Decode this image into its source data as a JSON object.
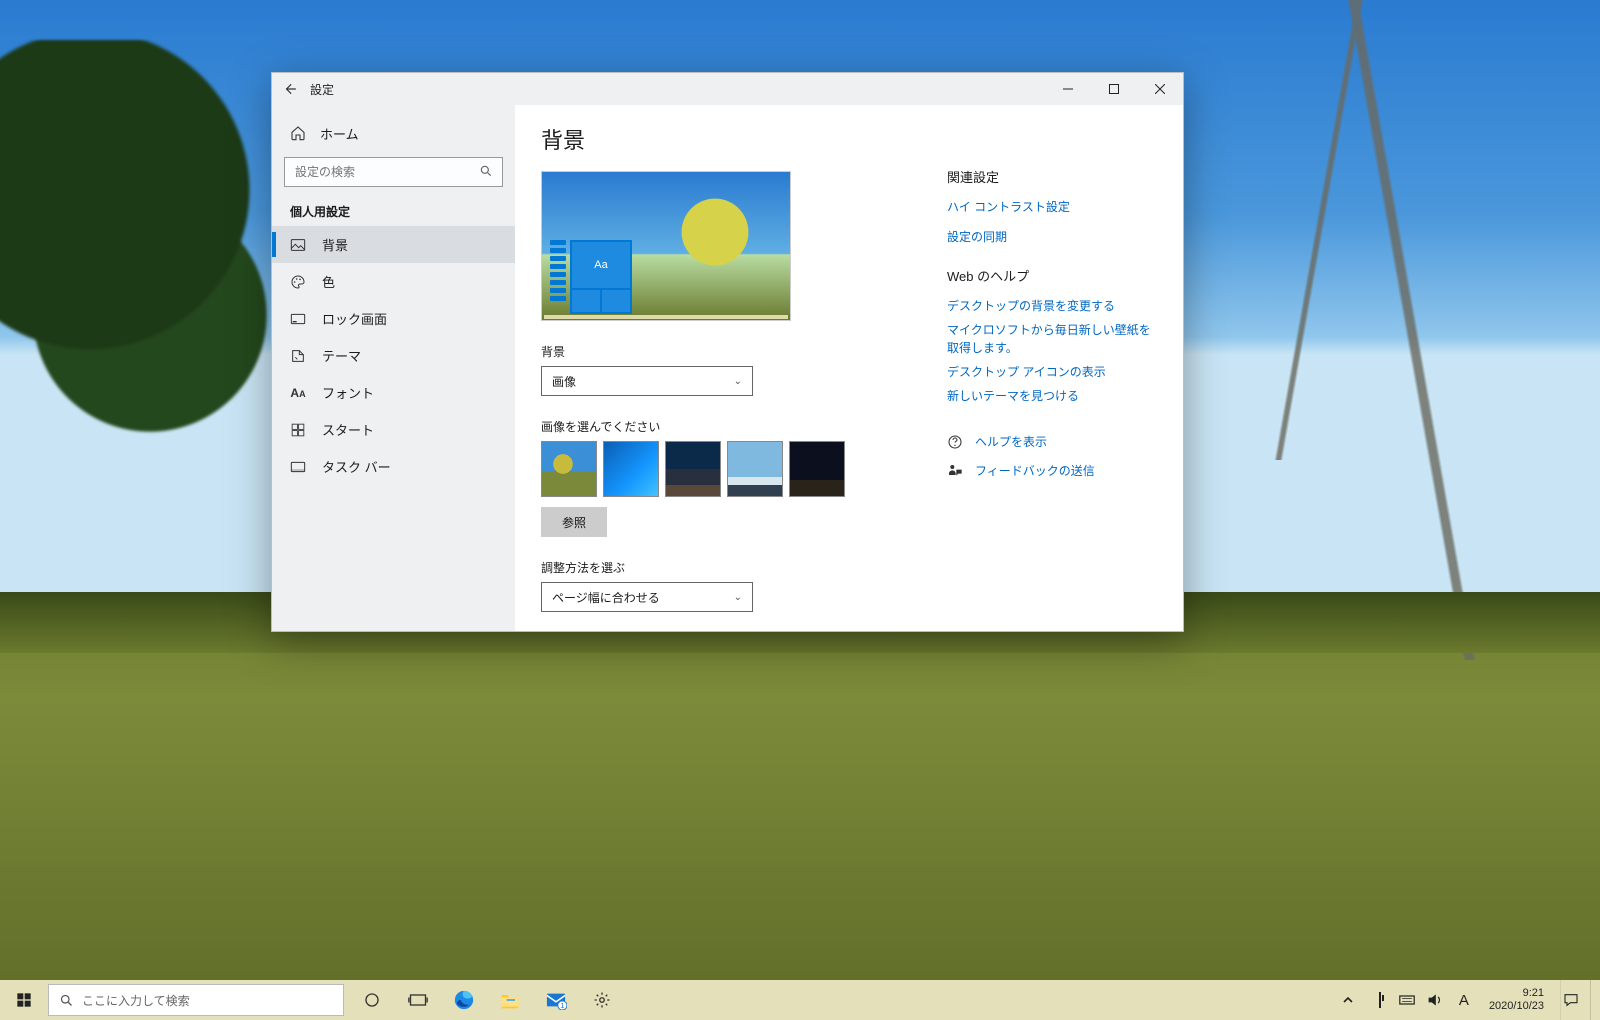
{
  "window": {
    "title": "設定",
    "home": "ホーム",
    "search_placeholder": "設定の検索",
    "category": "個人用設定",
    "nav": {
      "background": "背景",
      "colors": "色",
      "lockscreen": "ロック画面",
      "themes": "テーマ",
      "fonts": "フォント",
      "start": "スタート",
      "taskbar": "タスク バー"
    }
  },
  "page": {
    "heading": "背景",
    "preview_aa": "Aa",
    "bg_label": "背景",
    "bg_value": "画像",
    "choose_label": "画像を選んでください",
    "browse": "参照",
    "fit_label": "調整方法を選ぶ",
    "fit_value": "ページ幅に合わせる"
  },
  "side": {
    "related_head": "関連設定",
    "high_contrast": "ハイ コントラスト設定",
    "sync": "設定の同期",
    "web_head": "Web のヘルプ",
    "web1": "デスクトップの背景を変更する",
    "web2": "マイクロソフトから毎日新しい壁紙を取得します。",
    "web3": "デスクトップ アイコンの表示",
    "web4": "新しいテーマを見つける",
    "help": "ヘルプを表示",
    "feedback": "フィードバックの送信"
  },
  "taskbar": {
    "search_placeholder": "ここに入力して検索",
    "ime": "A",
    "time": "9:21",
    "date": "2020/10/23"
  }
}
